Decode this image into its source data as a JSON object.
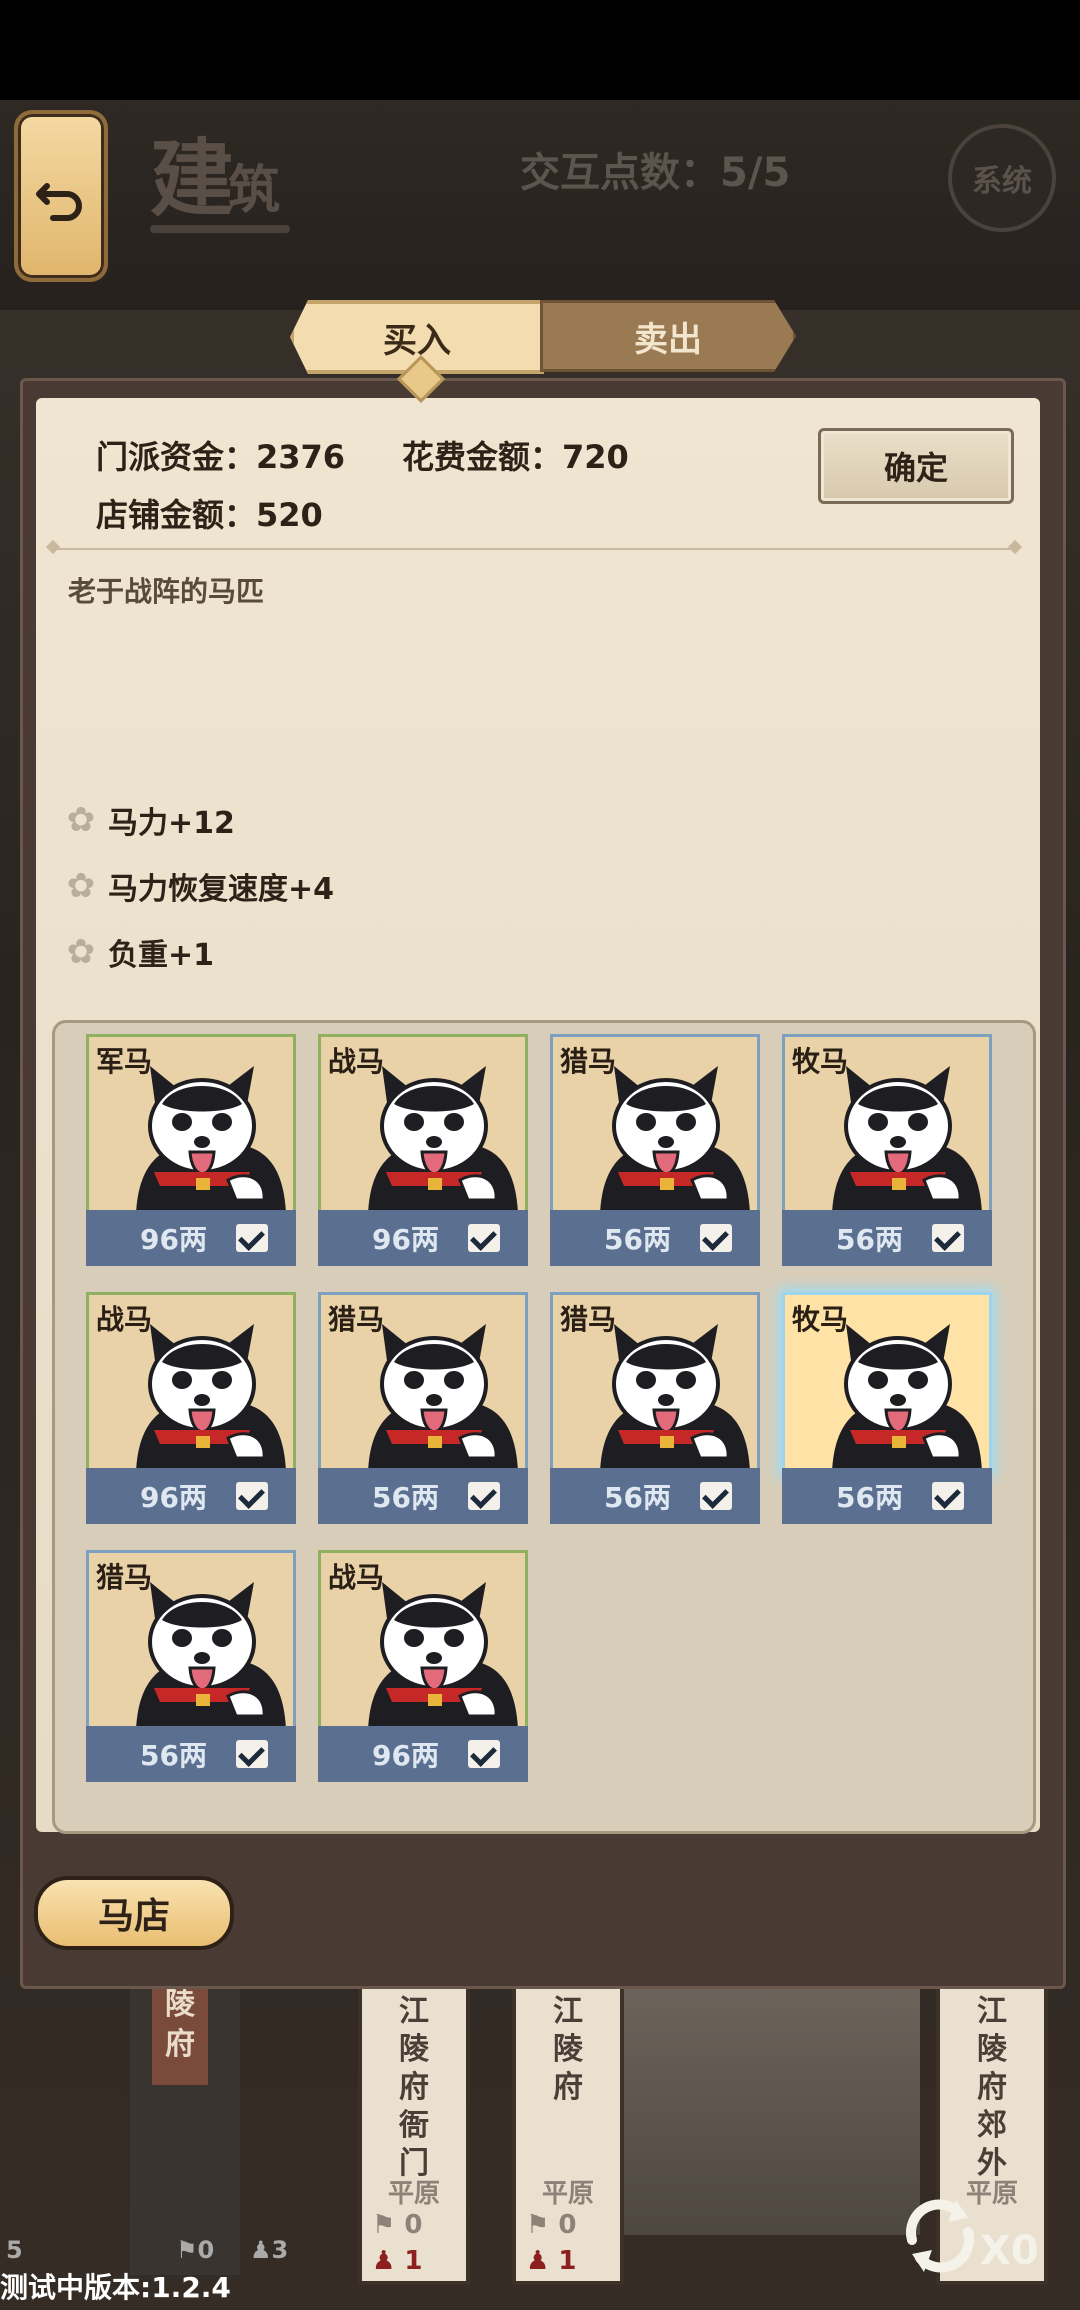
{
  "header": {
    "title": "建筑",
    "title_main": "建",
    "title_small": "筑",
    "interaction_points": "交互点数：5/5",
    "system_label": "系统"
  },
  "tabs": {
    "buy": "买入",
    "sell": "卖出",
    "active": "buy"
  },
  "info": {
    "sect_funds": "门派资金：2376",
    "spend_amount": "花费金额：720",
    "shop_amount": "店铺金额：520",
    "confirm_label": "确定"
  },
  "description": "老于战阵的马匹",
  "attributes": [
    {
      "icon": "star-icon",
      "text": "马力+12"
    },
    {
      "icon": "star-icon",
      "text": "马力恢复速度+4"
    },
    {
      "icon": "star-icon",
      "text": "负重+1"
    }
  ],
  "items": [
    {
      "name": "军马",
      "price": "96两",
      "checked": true,
      "frame": "green"
    },
    {
      "name": "战马",
      "price": "96两",
      "checked": true,
      "frame": "green"
    },
    {
      "name": "猎马",
      "price": "56两",
      "checked": true,
      "frame": "blue"
    },
    {
      "name": "牧马",
      "price": "56两",
      "checked": true,
      "frame": "blue"
    },
    {
      "name": "战马",
      "price": "96两",
      "checked": true,
      "frame": "green"
    },
    {
      "name": "猎马",
      "price": "56两",
      "checked": true,
      "frame": "blue"
    },
    {
      "name": "猎马",
      "price": "56两",
      "checked": true,
      "frame": "blue"
    },
    {
      "name": "牧马",
      "price": "56两",
      "checked": true,
      "frame": "blue",
      "selected": true
    },
    {
      "name": "猎马",
      "price": "56两",
      "checked": true,
      "frame": "blue"
    },
    {
      "name": "战马",
      "price": "96两",
      "checked": true,
      "frame": "green"
    }
  ],
  "shop_name": "马店",
  "background": {
    "locations": [
      {
        "name": "江陵府衙门",
        "terrain": "平原",
        "flags": "0",
        "people": "1"
      },
      {
        "name": "江陵府",
        "terrain": "平原",
        "flags": "0",
        "people": "1"
      },
      {
        "name": "江陵府郊外",
        "terrain": "平原"
      }
    ],
    "city_sign": "陵府",
    "city_counts": {
      "a": "0",
      "b": "3",
      "c": "5"
    }
  },
  "refresh_count": "X0",
  "version": "测试中版本:1.2.4",
  "colors": {
    "panel": "#efe5d1",
    "price_bar": "#5b7090",
    "frame_green": "#8fb060",
    "frame_blue": "#7d9fc0",
    "selected_glow": "#9fdcf4"
  }
}
